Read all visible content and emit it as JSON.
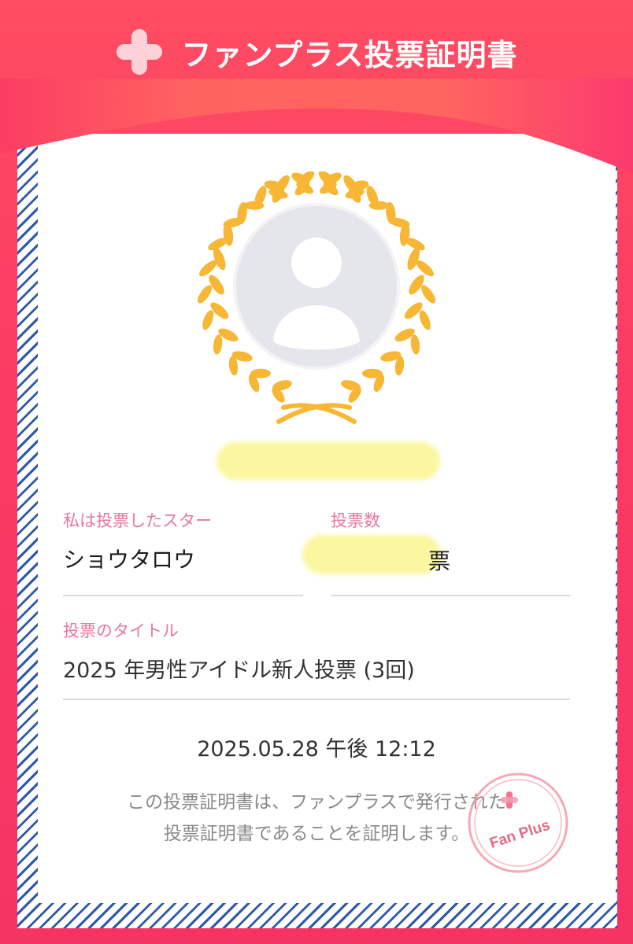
{
  "header": {
    "title": "ファンプラス投票証明書",
    "logo_icon": "fanplus-logo-icon"
  },
  "certificate": {
    "avatar_icon": "user-avatar-icon",
    "laurel_icon": "laurel-wreath-icon",
    "voter_name_label": "私は投票したスター",
    "voter_name_value": "ショウタロウ",
    "vote_count_label": "投票数",
    "vote_count_unit": "票",
    "vote_title_label": "投票のタイトル",
    "vote_title_value": "2025 年男性アイドル新人投票 (3回)",
    "timestamp": "2025.05.28 午後 12:12",
    "note_line1": "この投票証明書は、ファンプラスで発行された",
    "note_line2": "投票証明書であることを証明します。",
    "stamp_text": "Fan Plus"
  },
  "colors": {
    "brand_red": "#f53464",
    "label_pink": "#e7779c",
    "laurel_gold": "#f7b634",
    "stripe_blue": "#2f59a8"
  }
}
